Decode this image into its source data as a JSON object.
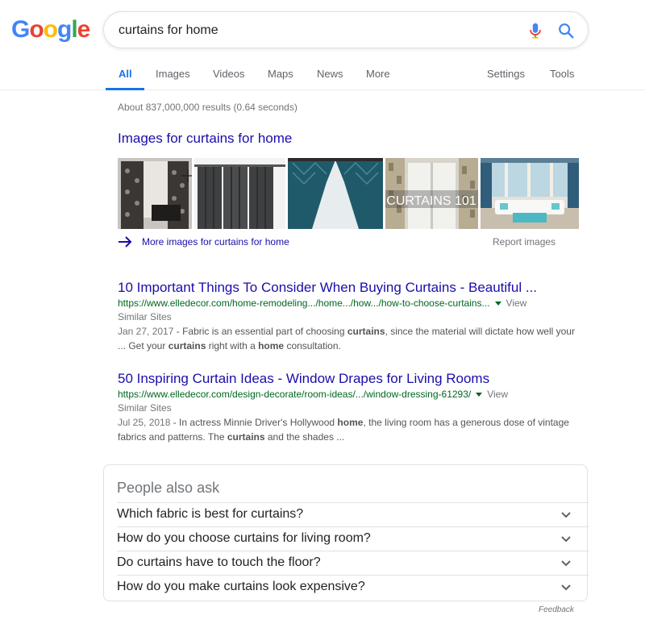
{
  "logo": {
    "letters": [
      "G",
      "o",
      "o",
      "g",
      "l",
      "e"
    ]
  },
  "search": {
    "query": "curtains for home",
    "placeholder": ""
  },
  "tabs": {
    "all": "All",
    "images": "Images",
    "videos": "Videos",
    "maps": "Maps",
    "news": "News",
    "more": "More",
    "settings": "Settings",
    "tools": "Tools"
  },
  "result_stats": "About 837,000,000 results (0.64 seconds)",
  "images_block": {
    "title": "Images for curtains for home",
    "thumb_text": "CURTAINS 101",
    "more_label": "More images for curtains for home",
    "report_label": "Report images"
  },
  "results": [
    {
      "title": "10 Important Things To Consider When Buying Curtains - Beautiful ...",
      "url": "https://www.elledecor.com/home-remodeling.../home.../how.../how-to-choose-curtains...",
      "view": "View",
      "similar": "Similar Sites",
      "date": "Jan 27, 2017",
      "snippet_parts": [
        " - Fabric is an essential part of choosing ",
        "curtains",
        ", since the material will dictate how well your ... Get your ",
        "curtains",
        " right with a ",
        "home",
        " consultation."
      ]
    },
    {
      "title": "50 Inspiring Curtain Ideas - Window Drapes for Living Rooms",
      "url": "https://www.elledecor.com/design-decorate/room-ideas/.../window-dressing-61293/",
      "view": "View",
      "similar": "Similar Sites",
      "date": "Jul 25, 2018",
      "snippet_parts": [
        " - In actress Minnie Driver's Hollywood ",
        "home",
        ", the living room has a generous dose of vintage fabrics and patterns. The ",
        "curtains",
        " and the shades ..."
      ]
    }
  ],
  "people_also_ask": {
    "title": "People also ask",
    "questions": [
      "Which fabric is best for curtains?",
      "How do you choose curtains for living room?",
      "Do curtains have to touch the floor?",
      "How do you make curtains look expensive?"
    ]
  },
  "feedback": "Feedback",
  "colors": {
    "link": "#1a0dab",
    "url_green": "#006621",
    "tab_active": "#1a73e8",
    "muted": "#70757a"
  }
}
